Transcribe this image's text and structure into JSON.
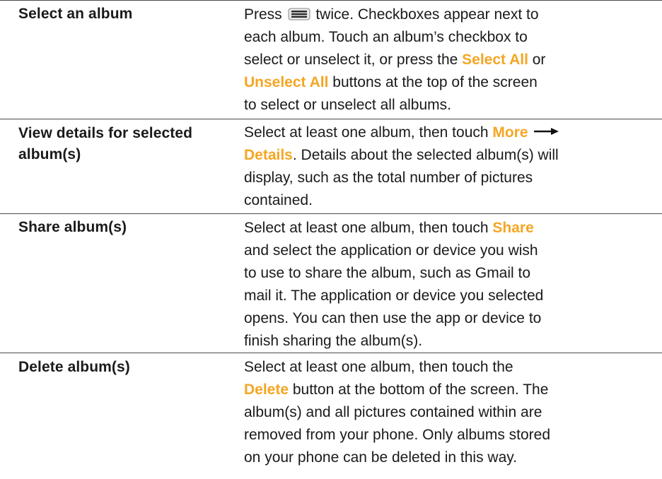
{
  "rows": [
    {
      "action": "Select an album",
      "desc": {
        "l1a": "Press ",
        "l1b": " twice. Checkboxes appear next to",
        "l2": "each album. Touch an album’s checkbox to",
        "l3a": "select or unselect it, or press the ",
        "l3hl": "Select All",
        "l3b": " or",
        "l4hl": "Unselect All",
        "l4b": " buttons at the top of the screen",
        "l5": "to select or unselect all albums."
      }
    },
    {
      "action_l1": "View details for selected",
      "action_l2": "album(s)",
      "desc": {
        "l1a": "Select at least one album, then touch ",
        "l1hl": "More",
        "l2hl": "Details",
        "l2b": ". Details about the selected album(s) will",
        "l3": "display, such as the total number of pictures",
        "l4": "contained."
      }
    },
    {
      "action": "Share album(s)",
      "desc": {
        "l1a": "Select at least one album, then touch ",
        "l1hl": "Share",
        "l2": "and select the application or device you wish",
        "l3": "to use to share the album, such as Gmail to",
        "l4": "mail it. The application or device you selected",
        "l5": "opens. You can then use the app or device to",
        "l6": "finish sharing the album(s)."
      }
    },
    {
      "action": "Delete album(s)",
      "desc": {
        "l1": "Select at least one album, then touch the",
        "l2hl": "Delete",
        "l2b": " button at the bottom of the screen. The",
        "l3": "album(s) and all pictures contained within are",
        "l4": "removed from your phone. Only albums stored",
        "l5": "on your phone can be deleted in this way."
      }
    }
  ],
  "icons": {
    "menu": "menu-icon",
    "arrow": "arrow-right-icon"
  },
  "colors": {
    "highlight": "#f5a623",
    "text": "#1a1a1a",
    "divider": "#4a4a4a"
  }
}
